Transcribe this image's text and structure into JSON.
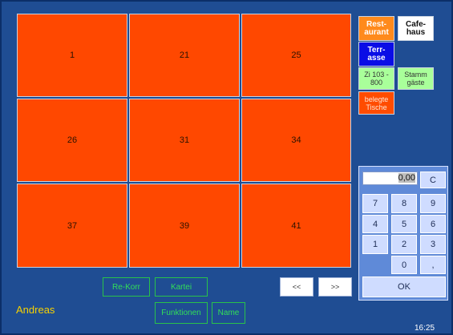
{
  "tables": [
    "1",
    "21",
    "25",
    "26",
    "31",
    "34",
    "37",
    "39",
    "41"
  ],
  "sidebar": {
    "restaurant": "Rest-\naurant",
    "cafehaus": "Cafe-\nhaus",
    "terrasse": "Terr-\nasse",
    "zimmer": "Zi 103 -\n800",
    "stammgaeste": "Stamm\ngäste",
    "belegte": "belegte\nTische"
  },
  "numpad": {
    "display": "0,00",
    "clear": "C",
    "keys": [
      "7",
      "8",
      "9",
      "4",
      "5",
      "6",
      "1",
      "2",
      "3",
      "0",
      ","
    ],
    "ok": "OK"
  },
  "bottom": {
    "re_korr": "Re-Korr",
    "kartei": "Kartei",
    "funktionen": "Funktionen",
    "name": "Name",
    "prev": "<<",
    "next": ">>"
  },
  "user": "Andreas",
  "time": "16:25",
  "colors": {
    "background": "#1f4d93",
    "table_free": "#ff4800",
    "restaurant": "#ff8a1c",
    "terrasse": "#0a0de6",
    "zimmer": "#a9ff9a",
    "belegte": "#ff4c00",
    "green_text": "#32df58",
    "user_text": "#f7d100"
  }
}
